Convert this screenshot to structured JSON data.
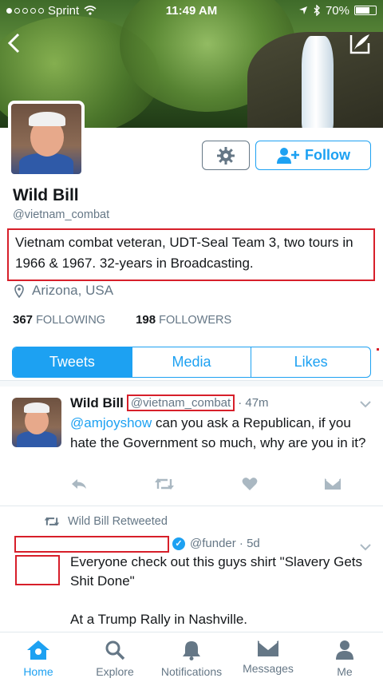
{
  "status_bar": {
    "carrier": "Sprint",
    "time": "11:49 AM",
    "battery": "70%",
    "battery_level": 0.7,
    "signal_bars": 1
  },
  "profile": {
    "name": "Wild Bill",
    "handle": "@vietnam_combat",
    "bio": "Vietnam combat veteran, UDT-Seal Team 3, two tours in 1966 & 1967. 32-years in Broadcasting.",
    "location": "Arizona, USA",
    "following_count": "367",
    "following_label": "FOLLOWING",
    "followers_count": "198",
    "followers_label": "FOLLOWERS",
    "follow_label": "Follow"
  },
  "tabs": [
    {
      "label": "Tweets",
      "active": true
    },
    {
      "label": "Media",
      "active": false
    },
    {
      "label": "Likes",
      "active": false
    }
  ],
  "tweet1": {
    "name": "Wild Bill",
    "handle": "@vietnam_combat",
    "time": "· 47m",
    "mention": "@amjoyshow",
    "text": " can you ask a Republican, if you hate the Government so much, why are you in it?"
  },
  "tweet2": {
    "retweet_line": "Wild Bill Retweeted",
    "meta": "@funder · 5d",
    "text": "Everyone check out this guys shirt \"Slavery Gets Shit Done\"\n\nAt a Trump Rally in Nashville."
  },
  "bottom_nav": [
    {
      "label": "Home",
      "icon": "home-icon",
      "active": true
    },
    {
      "label": "Explore",
      "icon": "search-icon",
      "active": false
    },
    {
      "label": "Notifications",
      "icon": "bell-icon",
      "active": false
    },
    {
      "label": "Messages",
      "icon": "envelope-icon",
      "active": false
    },
    {
      "label": "Me",
      "icon": "person-icon",
      "active": false
    }
  ],
  "colors": {
    "accent": "#1da1f2",
    "annotation_red": "#d71f2a",
    "muted": "#657786"
  }
}
